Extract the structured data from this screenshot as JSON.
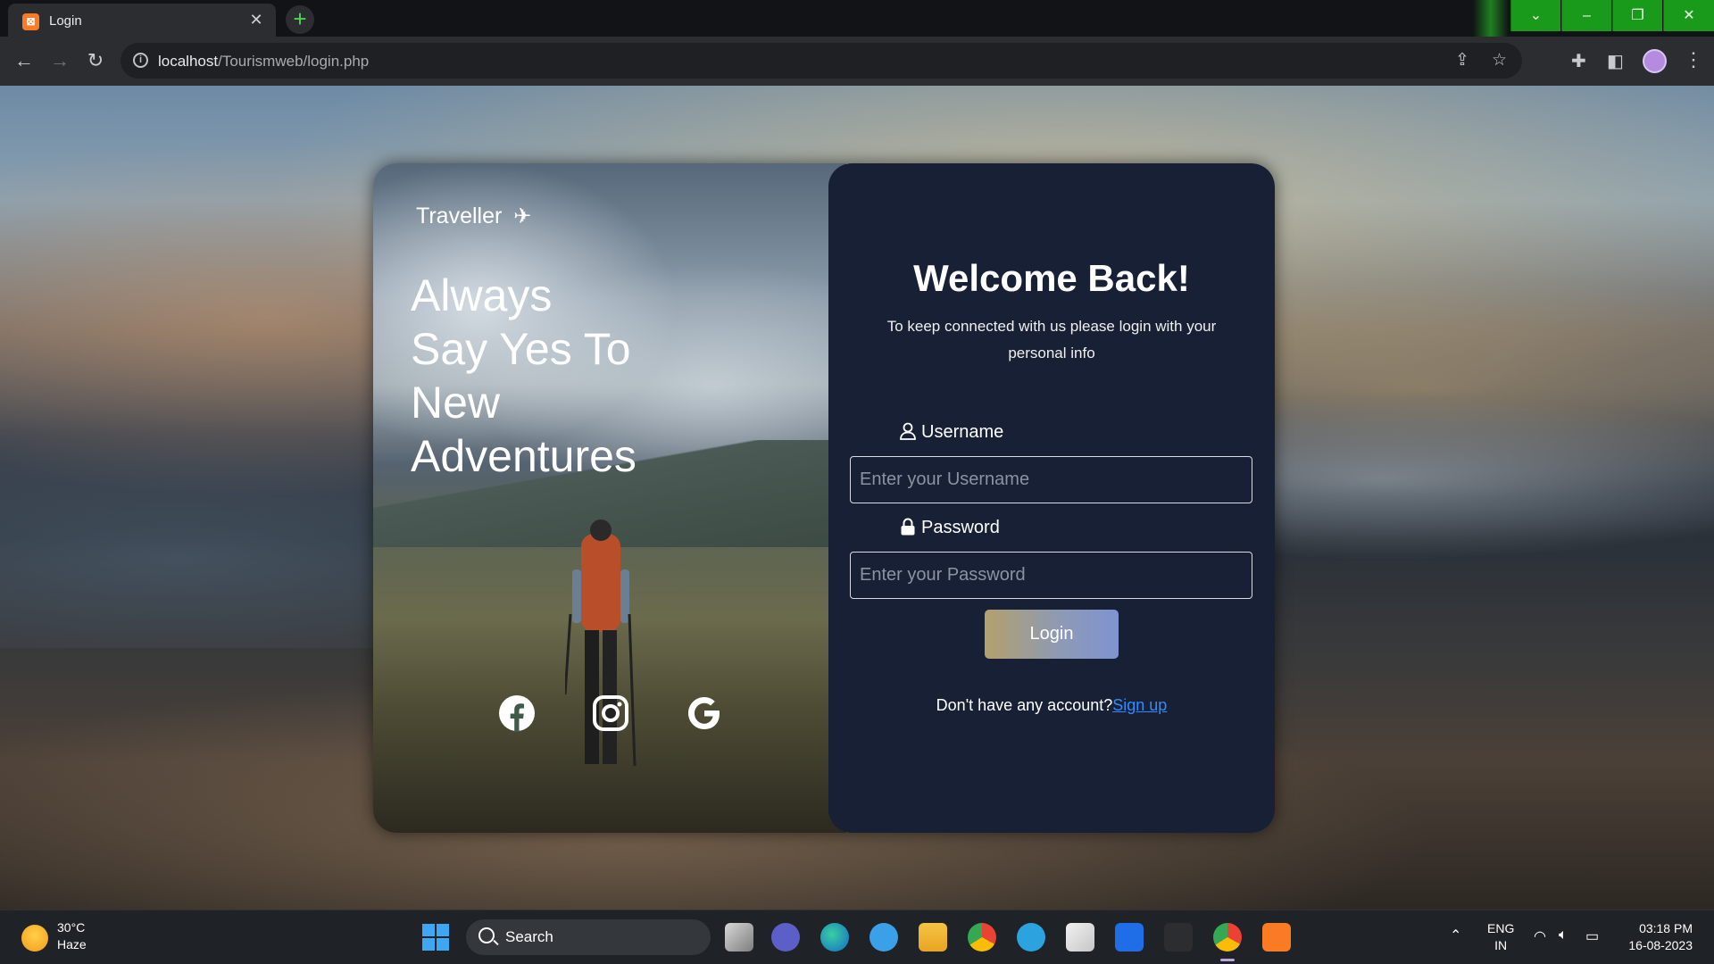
{
  "browser": {
    "tab_title": "Login",
    "tab_close": "✕",
    "new_tab": "+",
    "url_host": "localhost",
    "url_path": "/Tourismweb/login.php",
    "window_controls": [
      "⌄",
      "–",
      "❐",
      "✕"
    ]
  },
  "hero": {
    "brand": "Traveller",
    "tagline_lines": [
      "Always",
      "Say Yes To",
      "New",
      "Adventures"
    ],
    "socials": [
      "facebook-icon",
      "instagram-icon",
      "google-icon"
    ]
  },
  "login": {
    "title": "Welcome Back!",
    "subtitle": "To keep connected with us please login with your personal info",
    "username_label": "Username",
    "username_placeholder": "Enter your Username",
    "password_label": "Password",
    "password_placeholder": "Enter your Password",
    "button": "Login",
    "no_account": "Don't have any account?",
    "signup_link": "Sign up"
  },
  "taskbar": {
    "weather_temp": "30°C",
    "weather_desc": "Haze",
    "search_label": "Search",
    "lang_top": "ENG",
    "lang_bottom": "IN",
    "time": "03:18 PM",
    "date": "16-08-2023"
  },
  "colors": {
    "panel": "#172034",
    "link": "#2f8cff",
    "button_gradient_start": "#b3a06c",
    "button_gradient_end": "#7f93d2"
  }
}
